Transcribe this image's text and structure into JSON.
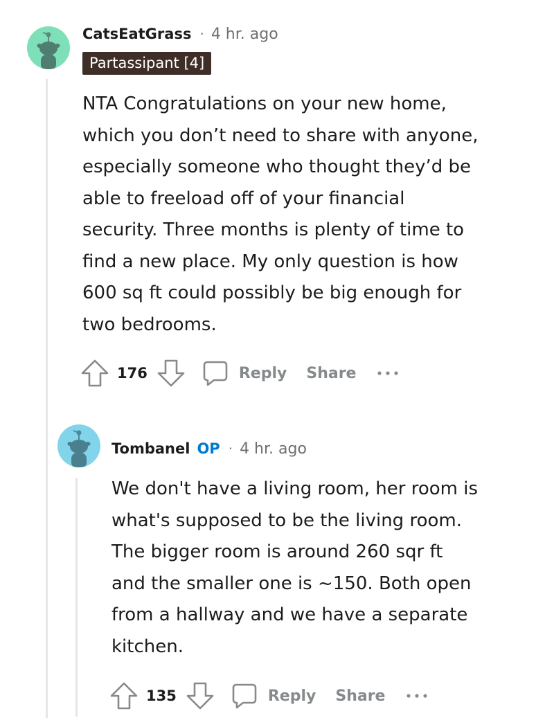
{
  "colors": {
    "avatar1_bg": "#7ee0b8",
    "avatar2_bg": "#82d4ea",
    "flair_bg": "#3e2e27",
    "op_badge": "#0079d3",
    "action_text": "#878a8c"
  },
  "comments": [
    {
      "avatar_icon": "snoo-avatar-icon",
      "username": "CatsEatGrass",
      "separator": "·",
      "time": "4 hr. ago",
      "flair": "Partassipant [4]",
      "body": [
        "NTA Congratulations on your new home,",
        "which you don’t need to share with anyone,",
        "especially someone who thought they’d be",
        "able to freeload off of your financial",
        "security. Three months is plenty of time to",
        "find a new place. My only question is how",
        "600 sq ft could possibly be big enough for",
        "two bedrooms."
      ],
      "score": "176",
      "reply_label": "Reply",
      "share_label": "Share"
    },
    {
      "avatar_icon": "snoo-avatar-icon",
      "username": "Tombanel",
      "op_badge": "OP",
      "separator": "·",
      "time": "4 hr. ago",
      "body": [
        "We don't have a living room, her room is",
        "what's supposed to be the living room.",
        "The bigger room is around 260 sqr ft",
        "and the smaller one is ~150. Both open",
        "from a hallway and we have a separate",
        "kitchen."
      ],
      "score": "135",
      "reply_label": "Reply",
      "share_label": "Share"
    }
  ]
}
